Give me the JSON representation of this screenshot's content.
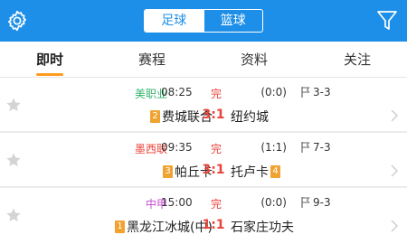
{
  "header": {
    "segments": [
      {
        "label": "足球",
        "active": true
      },
      {
        "label": "篮球",
        "active": false
      }
    ],
    "settings_icon": "gear-icon",
    "filter_icon": "filter-icon",
    "bg_color": "#1d8fe8"
  },
  "tabs": [
    {
      "label": "即时",
      "active": true
    },
    {
      "label": "赛程",
      "active": false
    },
    {
      "label": "资料",
      "active": false
    },
    {
      "label": "关注",
      "active": false
    }
  ],
  "matches": [
    {
      "league": "美职业",
      "league_color": "#34b26e",
      "time": "08:25",
      "status": "完",
      "home_rank": "2",
      "home": "费城联合",
      "score": "3:1",
      "away": "纽约城",
      "away_rank": "",
      "half": "(0:0)",
      "corners": "3-3"
    },
    {
      "league": "墨西联",
      "league_color": "#e8433a",
      "time": "09:35",
      "status": "完",
      "home_rank": "3",
      "home": "帕丘卡",
      "score": "3:1",
      "away": "托卢卡",
      "away_rank": "4",
      "half": "(1:1)",
      "corners": "7-3"
    },
    {
      "league": "中甲",
      "league_color": "#c84bd4",
      "time": "15:00",
      "status": "完",
      "home_rank": "1",
      "home": "黑龙江冰城(中)",
      "score": "1:1",
      "away": "石家庄功夫",
      "away_rank": "",
      "half": "(0:0)",
      "corners": "9-3"
    }
  ],
  "colors": {
    "accent": "#1d8fe8",
    "score_red": "#e8433a",
    "rank_badge": "#f0a330",
    "tab_indicator": "#ff9b20"
  }
}
